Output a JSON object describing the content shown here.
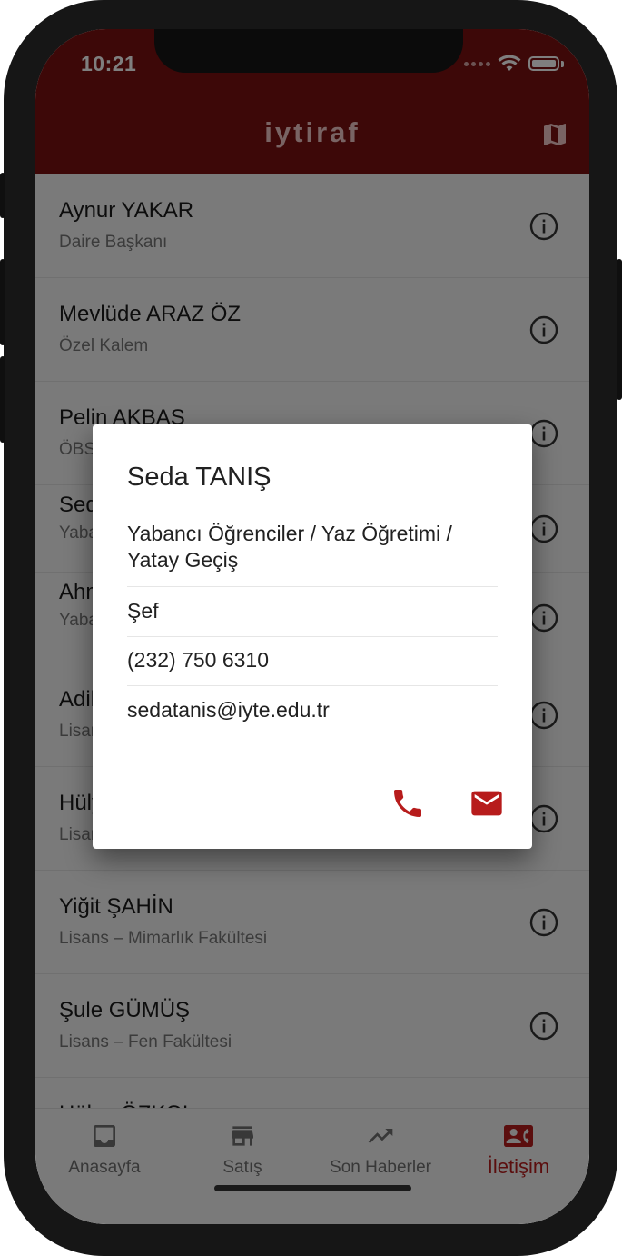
{
  "status_bar": {
    "time": "10:21"
  },
  "app_bar": {
    "title": "iytiraf"
  },
  "contacts": [
    {
      "name": "Aynur YAKAR",
      "role": "Daire Başkanı"
    },
    {
      "name": "Mevlüde ARAZ ÖZ",
      "role": "Özel Kalem"
    },
    {
      "name": "Pelin AKBAŞ",
      "role": "ÖBS"
    },
    {
      "name": "Seda TANIŞ",
      "role": "Yabancı Öğrenciler / Yaz Öğretimi / Yatay Geçiş"
    },
    {
      "name": "Ahmet",
      "role": "Yabancı Öğrenciler / Yaz Öğretimi / Yatay Geçiş"
    },
    {
      "name": "Adile",
      "role": "Lisans"
    },
    {
      "name": "Hülya",
      "role": "Lisans"
    },
    {
      "name": "Yiğit ŞAHİN",
      "role": "Lisans – Mimarlık Fakültesi"
    },
    {
      "name": "Şule GÜMÜŞ",
      "role": "Lisans – Fen Fakültesi"
    },
    {
      "name": "Hülya ÖZKOL",
      "role": ""
    }
  ],
  "dialog": {
    "name": "Seda TANIŞ",
    "department": "Yabancı Öğrenciler / Yaz Öğretimi / Yatay Geçiş",
    "title": "Şef",
    "phone": "(232) 750 6310",
    "email": "sedatanis@iyte.edu.tr"
  },
  "bottom_nav": [
    {
      "label": "Anasayfa",
      "icon": "inbox-icon",
      "active": false
    },
    {
      "label": "Satış",
      "icon": "store-icon",
      "active": false
    },
    {
      "label": "Son Haberler",
      "icon": "trending-up-icon",
      "active": false
    },
    {
      "label": "İletişim",
      "icon": "contact-phone-icon",
      "active": true
    }
  ],
  "colors": {
    "app_bar": "#7a1110",
    "accent": "#b71c1c",
    "title_text": "#f2c9c9"
  }
}
